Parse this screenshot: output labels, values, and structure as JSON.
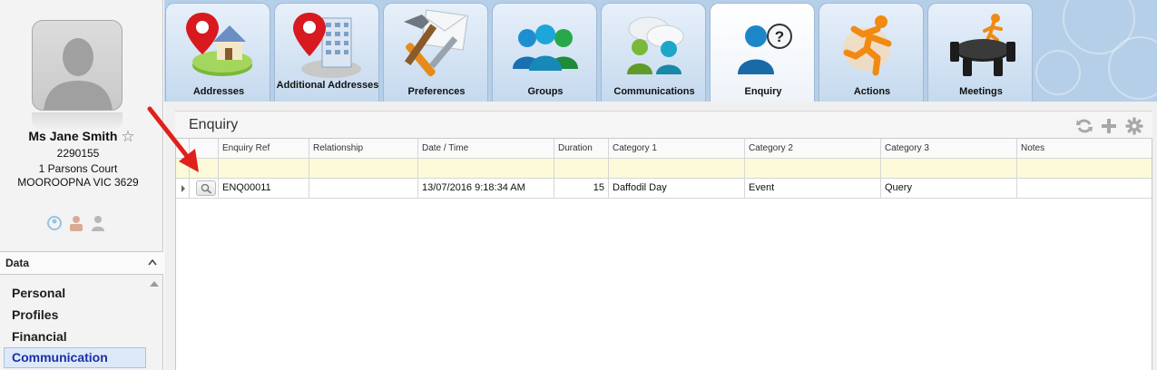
{
  "contact": {
    "name": "Ms Jane Smith",
    "id": "2290155",
    "street": "1 Parsons Court",
    "suburb": "MOOROOPNA VIC 3629"
  },
  "sidebar": {
    "section_title": "Data",
    "items": [
      {
        "label": "Personal",
        "active": false
      },
      {
        "label": "Profiles",
        "active": false
      },
      {
        "label": "Financial",
        "active": false
      },
      {
        "label": "Communication",
        "active": true
      }
    ]
  },
  "tabs": [
    {
      "label": "Addresses",
      "icon": "house-pin-icon"
    },
    {
      "label": "Additional Addresses",
      "icon": "building-pin-icon"
    },
    {
      "label": "Preferences",
      "icon": "tools-icon"
    },
    {
      "label": "Groups",
      "icon": "group-icon"
    },
    {
      "label": "Communications",
      "icon": "chat-people-icon"
    },
    {
      "label": "Enquiry",
      "icon": "person-question-icon",
      "active": true
    },
    {
      "label": "Actions",
      "icon": "runner-icon"
    },
    {
      "label": "Meetings",
      "icon": "meeting-table-icon"
    }
  ],
  "panel": {
    "title": "Enquiry"
  },
  "grid": {
    "columns": [
      "Enquiry Ref",
      "Relationship",
      "Date / Time",
      "Duration",
      "Category 1",
      "Category 2",
      "Category 3",
      "Notes"
    ],
    "rows": [
      {
        "ref": "ENQ00011",
        "relationship": "",
        "datetime": "13/07/2016 9:18:34 AM",
        "duration": "15",
        "category1": "Daffodil Day",
        "category2": "Event",
        "category3": "Query",
        "notes": ""
      }
    ]
  },
  "colors": {
    "tabbar_bg": "#b6cfe8",
    "active_nav": "#1a2fa8",
    "filter_row": "#fcfad9",
    "arrow": "#e0201b"
  }
}
